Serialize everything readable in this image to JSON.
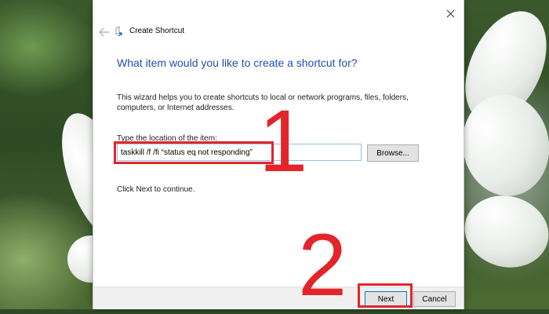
{
  "dialog": {
    "title": "Create Shortcut",
    "heading": "What item would you like to create a shortcut for?",
    "description": "This wizard helps you to create shortcuts to local or network programs, files, folders, computers, or Internet addresses.",
    "location_label": "Type the location of the item:",
    "location_value": "taskkill /f /fi “status eq not responding”",
    "browse_label": "Browse...",
    "hint": "Click Next to continue.",
    "next_label": "Next",
    "cancel_label": "Cancel"
  },
  "annotations": {
    "step1": "1",
    "step2": "2",
    "color": "#e3242b"
  },
  "icons": {
    "close": "close-icon",
    "back": "back-arrow-icon",
    "shortcut": "shortcut-icon"
  }
}
